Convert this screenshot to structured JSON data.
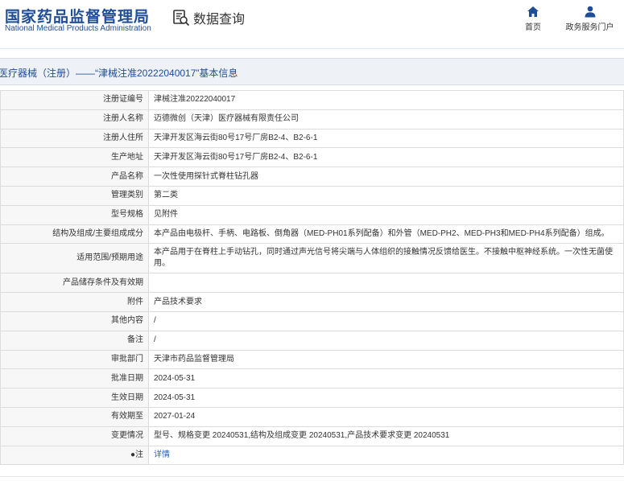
{
  "header": {
    "logo_cn": "国家药品监督管理局",
    "logo_en": "National Medical Products Administration",
    "data_query": "数据查询",
    "nav": {
      "home": "首页",
      "service": "政务服务门户"
    },
    "brand_color": "#1f4d96",
    "icons": [
      "search-doc-icon",
      "home-icon",
      "user-icon"
    ]
  },
  "title": "医疗器械（注册）——“津械注准20222040017”基本信息",
  "rows": [
    {
      "label": "注册证编号",
      "value": "津械注准20222040017"
    },
    {
      "label": "注册人名称",
      "value": "迈德微创（天津）医疗器械有限责任公司"
    },
    {
      "label": "注册人住所",
      "value": "天津开发区海云街80号17号厂房B2-4、B2-6-1"
    },
    {
      "label": "生产地址",
      "value": "天津开发区海云街80号17号厂房B2-4、B2-6-1"
    },
    {
      "label": "产品名称",
      "value": "一次性使用探针式脊柱钻孔器"
    },
    {
      "label": "管理类别",
      "value": "第二类"
    },
    {
      "label": "型号规格",
      "value": "见附件"
    },
    {
      "label": "结构及组成/主要组成成分",
      "value": "本产品由电极杆、手柄、电路板、倒角器（MED-PH01系列配备）和外管（MED-PH2、MED-PH3和MED-PH4系列配备）组成。"
    },
    {
      "label": "适用范围/预期用途",
      "value": "本产品用于在脊柱上手动钻孔，同时通过声光信号将尖端与人体组织的接触情况反馈给医生。不接触中枢神经系统。一次性无菌使用。"
    },
    {
      "label": "产品储存条件及有效期",
      "value": ""
    },
    {
      "label": "附件",
      "value": "产品技术要求"
    },
    {
      "label": "其他内容",
      "value": "/"
    },
    {
      "label": "备注",
      "value": "/"
    },
    {
      "label": "审批部门",
      "value": "天津市药品监督管理局"
    },
    {
      "label": "批准日期",
      "value": "2024-05-31"
    },
    {
      "label": "生效日期",
      "value": "2024-05-31"
    },
    {
      "label": "有效期至",
      "value": "2027-01-24"
    },
    {
      "label": "变更情况",
      "value": "型号、规格变更 20240531,结构及组成变更 20240531,产品技术要求变更 20240531"
    },
    {
      "label": "●注",
      "value": "详情"
    }
  ]
}
